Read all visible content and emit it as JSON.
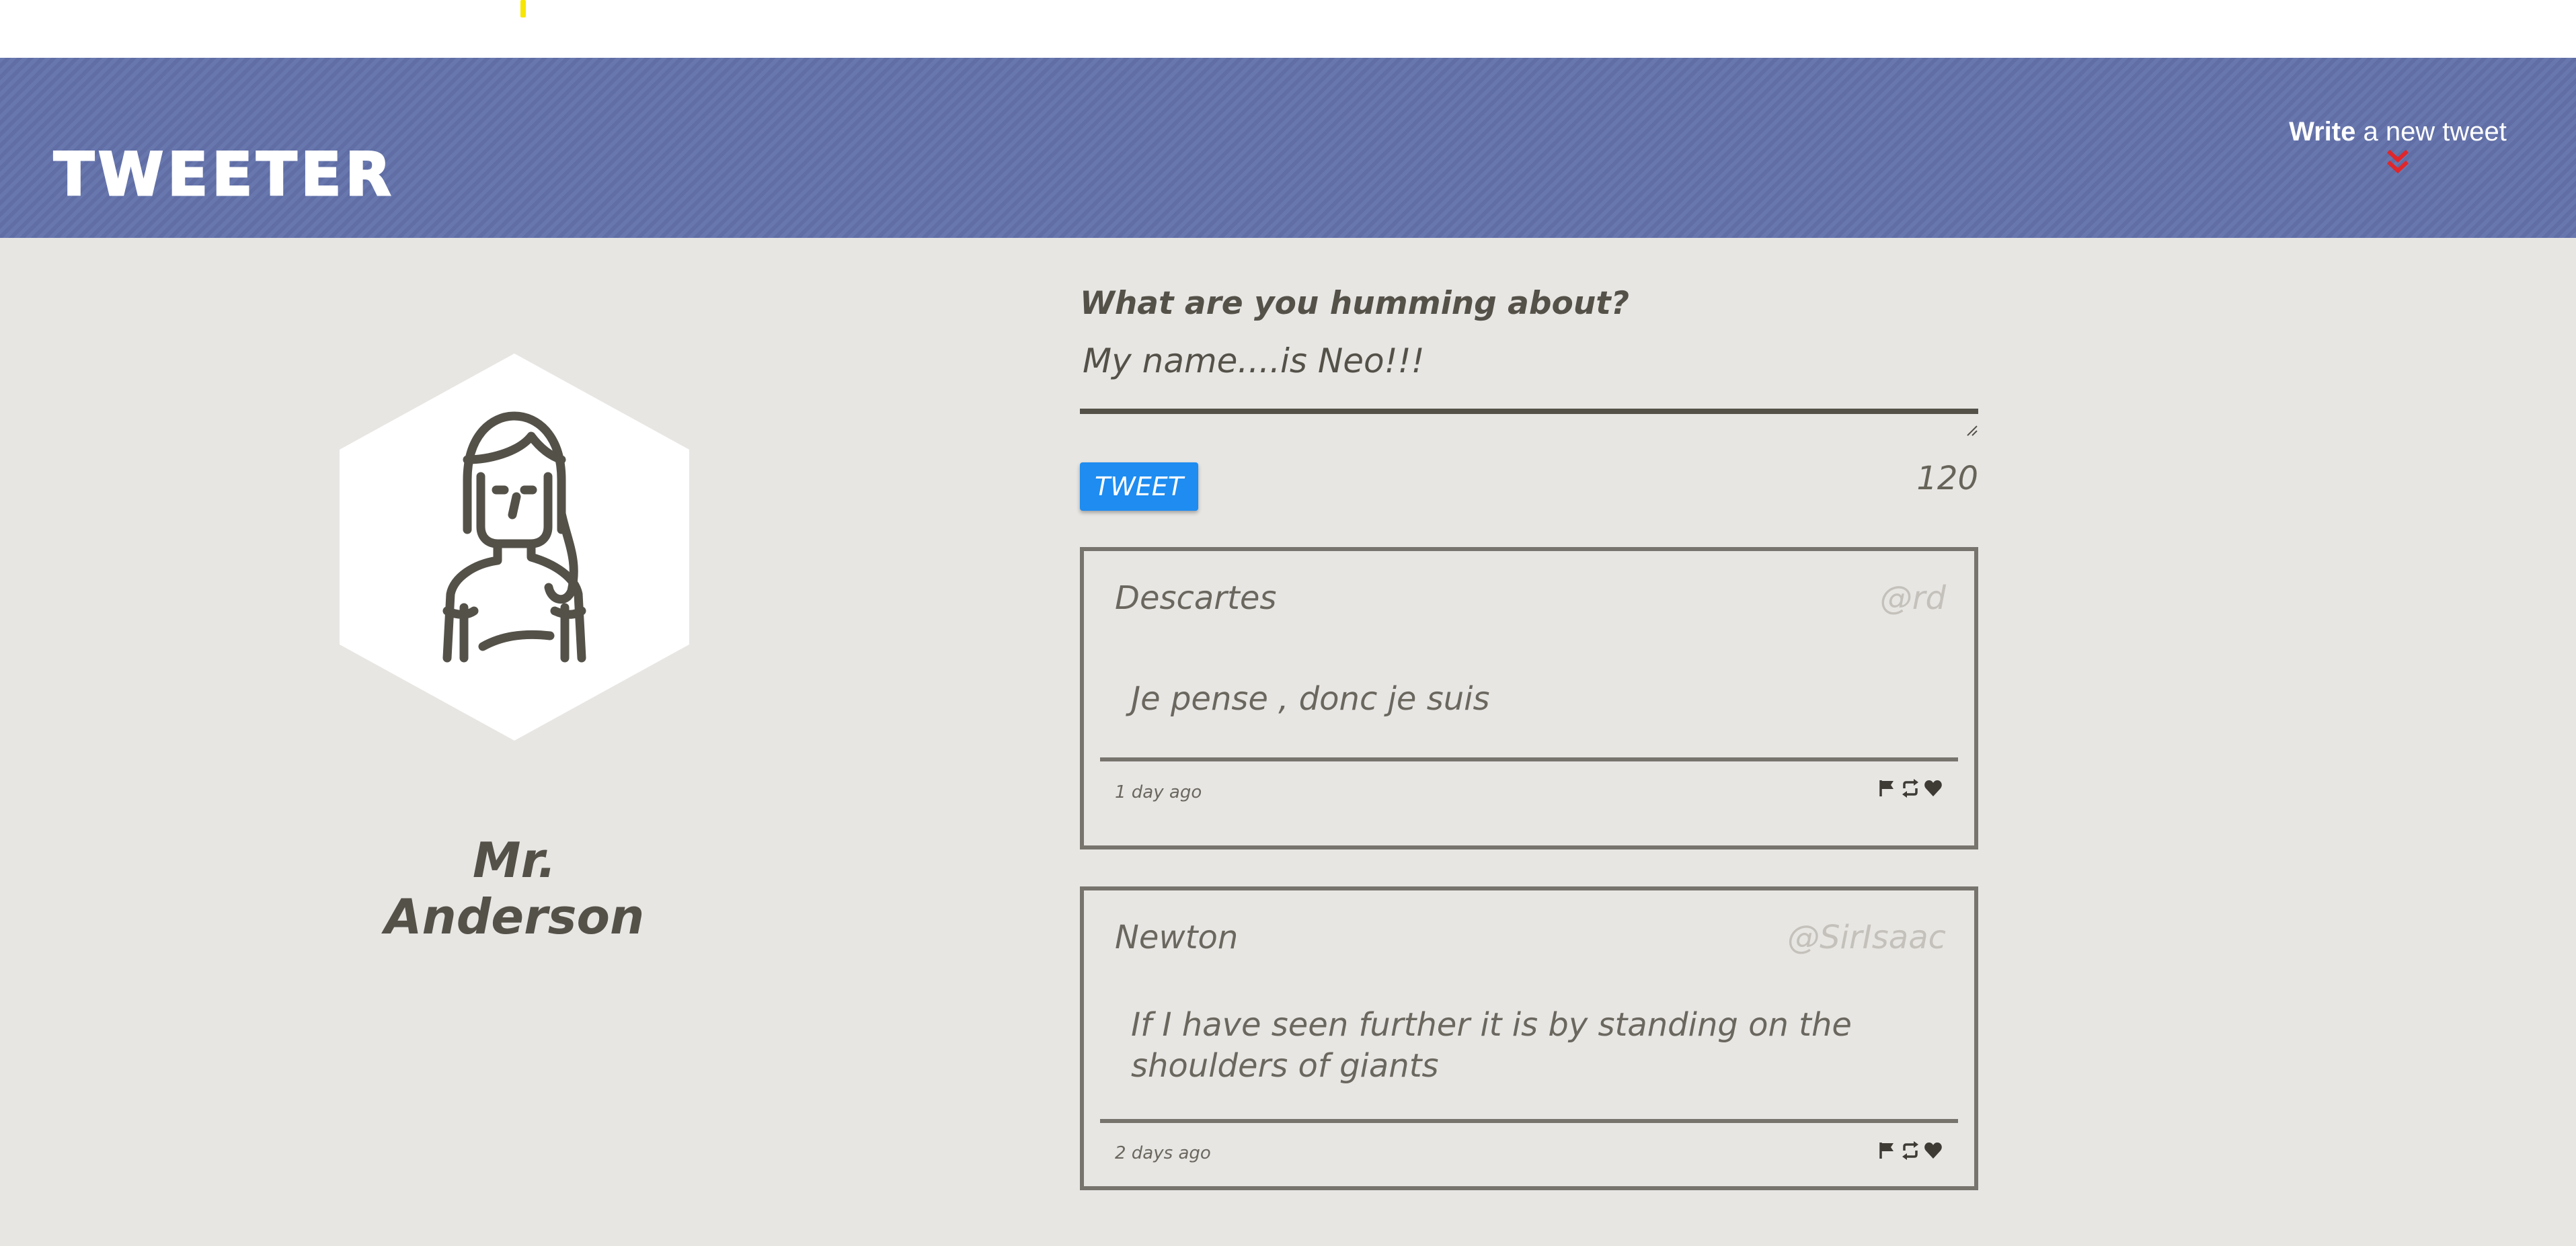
{
  "header": {
    "brand": "TWEETER",
    "compose_toggle": {
      "strong": "Write",
      "rest": " a new tweet",
      "icon": "chevron-double-down-icon"
    }
  },
  "profile": {
    "name": "Mr. Anderson",
    "avatar_icon": "woman-avatar-icon"
  },
  "composer": {
    "label": "What are you humming about?",
    "text_value": "My name....is Neo!!!",
    "tweet_button": "TWEET",
    "char_count": "120"
  },
  "tweets": [
    {
      "name": "Descartes",
      "handle": "@rd",
      "body": "Je pense , donc je suis",
      "age": "1 day ago",
      "actions": [
        "flag-icon",
        "retweet-icon",
        "heart-icon"
      ]
    },
    {
      "name": "Newton",
      "handle": "@SirIsaac",
      "body": "If I have seen further it is by standing on the shoulders of giants",
      "age": "2 days ago",
      "actions": [
        "flag-icon",
        "retweet-icon",
        "heart-icon"
      ]
    }
  ],
  "colors": {
    "navbar": "#6372ab",
    "background": "#e8e6e3",
    "accent_button": "#1e8cf0",
    "chevron": "#e0262a",
    "text_dark": "#545149"
  }
}
